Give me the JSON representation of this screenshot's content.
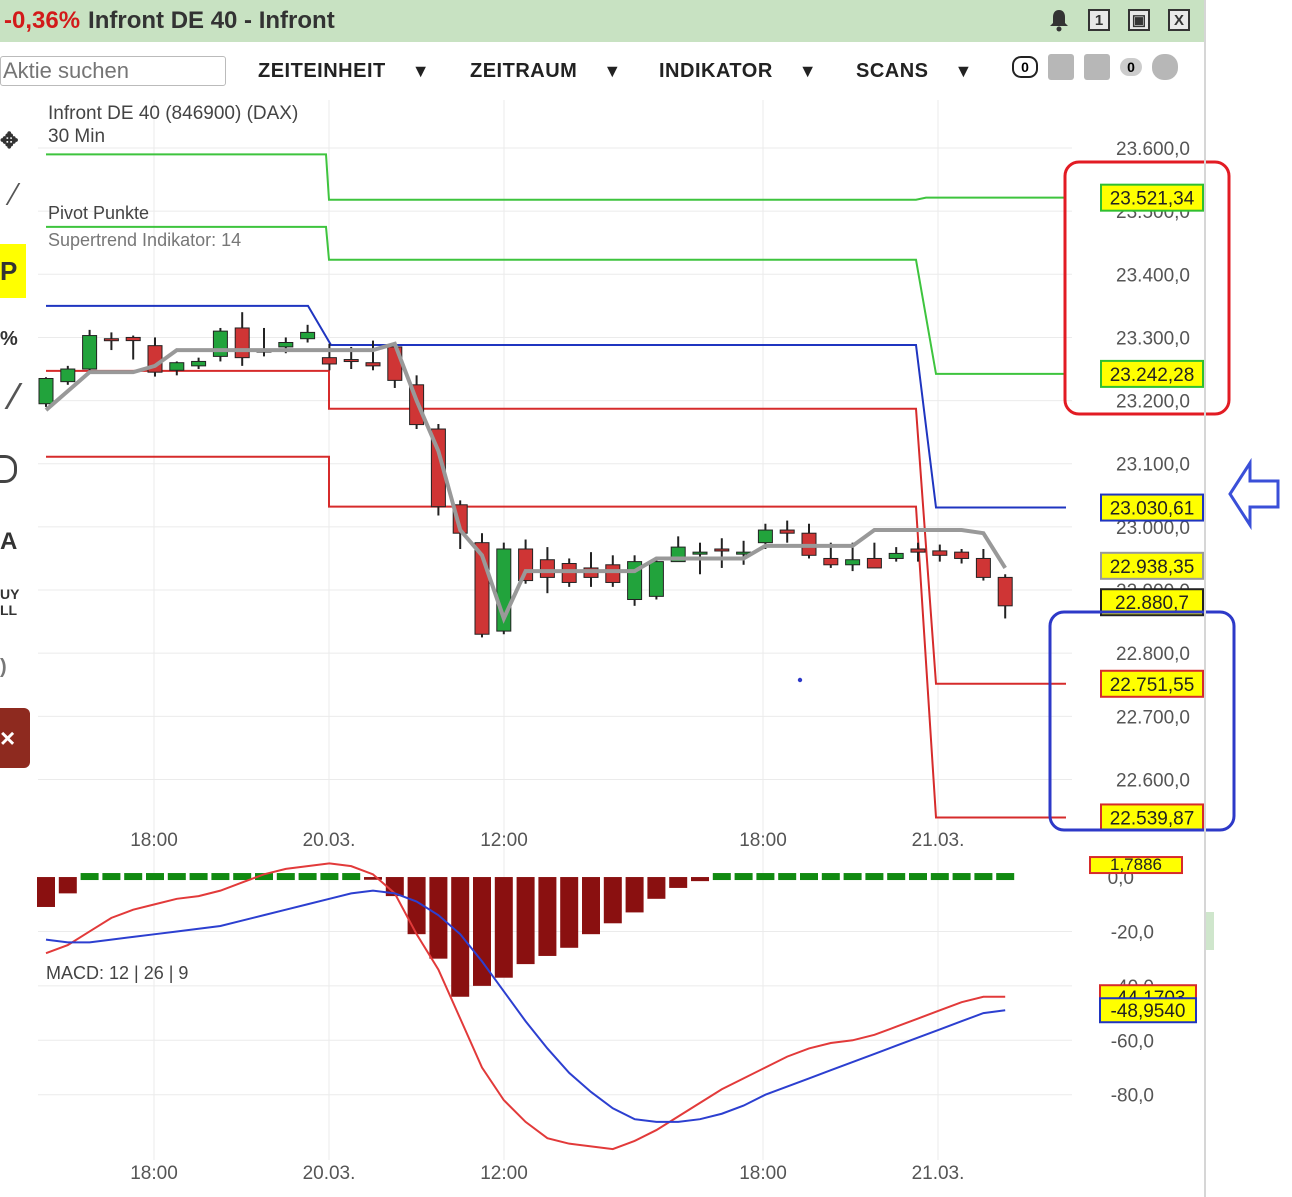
{
  "window": {
    "change": "-0,36%",
    "title": "Infront DE 40 - Infront",
    "buttons": [
      "1",
      "▣",
      "X"
    ]
  },
  "toolbar": {
    "search_placeholder": "Aktie suchen",
    "menus": [
      "ZEITEINHEIT",
      "ZEITRAUM",
      "INDIKATOR",
      "SCANS"
    ],
    "badge1": "0",
    "badge2": "0"
  },
  "tools": [
    "P",
    "%",
    "A",
    "UY",
    "LL"
  ],
  "chart_data": {
    "type": "candlestick",
    "title": "Infront DE 40 (846900) (DAX)",
    "subtitle": "30 Min",
    "indicators": [
      "Pivot Punkte",
      "Supertrend Indikator: 14"
    ],
    "price_ticks": [
      "23.600,0",
      "23.500,0",
      "23.400,0",
      "23.300,0",
      "23.200,0",
      "23.100,0",
      "23.000,0",
      "22.900,0",
      "22.800,0",
      "22.700,0",
      "22.600,0"
    ],
    "price_range": [
      22520,
      23600
    ],
    "x_labels": [
      "18:00",
      "20.03.",
      "12:00",
      "18:00",
      "21.03."
    ],
    "candles": [
      [
        23195,
        23237,
        23190,
        23235
      ],
      [
        23230,
        23255,
        23225,
        23250
      ],
      [
        23250,
        23312,
        23245,
        23303
      ],
      [
        23298,
        23308,
        23280,
        23296
      ],
      [
        23300,
        23303,
        23265,
        23295
      ],
      [
        23287,
        23300,
        23238,
        23245
      ],
      [
        23248,
        23262,
        23240,
        23260
      ],
      [
        23255,
        23268,
        23250,
        23262
      ],
      [
        23270,
        23315,
        23262,
        23310
      ],
      [
        23315,
        23340,
        23255,
        23268
      ],
      [
        23278,
        23315,
        23270,
        23280
      ],
      [
        23285,
        23300,
        23275,
        23292
      ],
      [
        23298,
        23320,
        23292,
        23308
      ],
      [
        23268,
        23290,
        23248,
        23258
      ],
      [
        23265,
        23285,
        23250,
        23262
      ],
      [
        23260,
        23295,
        23248,
        23255
      ],
      [
        23285,
        23290,
        23220,
        23232
      ],
      [
        23225,
        23240,
        23155,
        23162
      ],
      [
        23155,
        23163,
        23018,
        23032
      ],
      [
        23035,
        23042,
        22965,
        22990
      ],
      [
        22975,
        22990,
        22825,
        22830
      ],
      [
        22835,
        22975,
        22830,
        22965
      ],
      [
        22965,
        22980,
        22910,
        22915
      ],
      [
        22948,
        22968,
        22895,
        22920
      ],
      [
        22942,
        22950,
        22905,
        22912
      ],
      [
        22935,
        22960,
        22905,
        22920
      ],
      [
        22940,
        22955,
        22905,
        22912
      ],
      [
        22885,
        22955,
        22875,
        22945
      ],
      [
        22890,
        22948,
        22885,
        22945
      ],
      [
        22945,
        22985,
        22945,
        22968
      ],
      [
        22960,
        22975,
        22925,
        22960
      ],
      [
        22965,
        22982,
        22935,
        22962
      ],
      [
        22960,
        22978,
        22940,
        22960
      ],
      [
        22975,
        23005,
        22965,
        22995
      ],
      [
        22995,
        23010,
        22975,
        22990
      ],
      [
        22990,
        23005,
        22950,
        22955
      ],
      [
        22950,
        22975,
        22935,
        22940
      ],
      [
        22940,
        22975,
        22930,
        22948
      ],
      [
        22950,
        22975,
        22935,
        22935
      ],
      [
        22950,
        22968,
        22945,
        22958
      ],
      [
        22965,
        22975,
        22945,
        22960
      ],
      [
        22962,
        22972,
        22945,
        22955
      ],
      [
        22960,
        22965,
        22942,
        22950
      ],
      [
        22950,
        22965,
        22915,
        22920
      ],
      [
        22920,
        22925,
        22855,
        22875
      ]
    ],
    "supertrend": [
      23185,
      23215,
      23245,
      23245,
      23245,
      23255,
      23280,
      23280,
      23280,
      23280,
      23280,
      23280,
      23280,
      23280,
      23280,
      23280,
      23290,
      23200,
      23120,
      22995,
      22955,
      22855,
      22930,
      22930,
      22930,
      22930,
      22930,
      22930,
      22950,
      22950,
      22950,
      22950,
      22950,
      22970,
      22970,
      22970,
      22970,
      22970,
      22995,
      22995,
      22995,
      22995,
      22995,
      22990,
      22935
    ],
    "pivot_lines": [
      {
        "color": "#3ec43e",
        "points": [
          [
            0,
            23590
          ],
          [
            280,
            23590
          ],
          [
            283,
            23518
          ],
          [
            870,
            23518
          ],
          [
            880,
            23521.34
          ],
          [
            1020,
            23521.34
          ]
        ]
      },
      {
        "color": "#3ec43e",
        "points": [
          [
            0,
            23475
          ],
          [
            280,
            23475
          ],
          [
            283,
            23423
          ],
          [
            870,
            23423
          ],
          [
            890,
            23242.28
          ],
          [
            1020,
            23242.28
          ]
        ]
      },
      {
        "color": "#1f35c0",
        "points": [
          [
            0,
            23350
          ],
          [
            262,
            23350
          ],
          [
            285,
            23288
          ],
          [
            870,
            23288
          ],
          [
            890,
            23030.61
          ],
          [
            1020,
            23030.61
          ]
        ]
      },
      {
        "color": "#d62b2b",
        "points": [
          [
            0,
            23247
          ],
          [
            283,
            23247
          ],
          [
            283,
            23187
          ],
          [
            870,
            23187
          ],
          [
            890,
            22751.55
          ],
          [
            1020,
            22751.55
          ]
        ]
      },
      {
        "color": "#d62b2b",
        "points": [
          [
            0,
            23111
          ],
          [
            283,
            23111
          ],
          [
            283,
            23032
          ],
          [
            870,
            23032
          ],
          [
            890,
            22539.87
          ],
          [
            1020,
            22539.87
          ]
        ]
      }
    ],
    "price_labels": [
      {
        "text": "23.521,34",
        "value": 23521.34,
        "bg": "#ffff00",
        "border": "#2fbf2f"
      },
      {
        "text": "23.242,28",
        "value": 23242.28,
        "bg": "#ffff00",
        "border": "#2fbf2f"
      },
      {
        "text": "23.030,61",
        "value": 23030.61,
        "bg": "#ffff00",
        "border": "#1f35c0"
      },
      {
        "text": "22.938,35",
        "value": 22938.35,
        "bg": "#ffff00",
        "border": "#9a9a9a"
      },
      {
        "text": "22.880,7",
        "value": 22880.7,
        "bg": "#ffff00",
        "border": "#222222"
      },
      {
        "text": "22.751,55",
        "value": 22751.55,
        "bg": "#ffff00",
        "border": "#d62b2b"
      },
      {
        "text": "22.539,87",
        "value": 22539.87,
        "bg": "#ffff00",
        "border": "#d62b2b"
      }
    ],
    "macd": {
      "label": "MACD: 12 | 26 | 9",
      "ticks": [
        "-20,0",
        "-40,0",
        "-60,0",
        "-80,0"
      ],
      "zero_tick": "0,0",
      "range": [
        -104,
        7
      ],
      "histogram": [
        -11,
        -6,
        0.5,
        0.5,
        0.5,
        0.5,
        0.5,
        0.5,
        0.5,
        0.5,
        0.5,
        0.5,
        0.5,
        0.5,
        0.5,
        -1,
        -7,
        -21,
        -30,
        -44,
        -40,
        -37,
        -32,
        -29,
        -26,
        -21,
        -17,
        -13,
        -8,
        -4,
        -1.5,
        0.5,
        0.5,
        0.5,
        0.5,
        0.5,
        0.5,
        0.5,
        0.5,
        0.5,
        0.5,
        0.5,
        0.5,
        0.5,
        0.5
      ],
      "macd_line": [
        -28,
        -25,
        -20,
        -15,
        -12,
        -10,
        -8,
        -7,
        -5,
        -2,
        1,
        3,
        4,
        5,
        4,
        1,
        -6,
        -21,
        -34,
        -52,
        -70,
        -82,
        -90,
        -96,
        -98,
        -99,
        -100,
        -97,
        -93,
        -88,
        -83,
        -78,
        -74,
        -70,
        -66,
        -63,
        -61,
        -60,
        -58,
        -55,
        -52,
        -49,
        -46,
        -44,
        -44
      ],
      "signal_line": [
        -23,
        -24,
        -24,
        -23,
        -22,
        -21,
        -20,
        -19,
        -18,
        -16,
        -14,
        -12,
        -10,
        -8,
        -6,
        -5,
        -6,
        -9,
        -14,
        -21,
        -31,
        -42,
        -53,
        -63,
        -72,
        -79,
        -85,
        -89,
        -90,
        -90,
        -89,
        -87,
        -84,
        -80,
        -77,
        -74,
        -71,
        -68,
        -65,
        -62,
        -59,
        -56,
        -53,
        -50,
        -48.954
      ],
      "labels": [
        {
          "text": "-44,1703",
          "value": -44.1703,
          "bg": "#ffff00",
          "border": "#d62b2b"
        },
        {
          "text": "-48,9540",
          "value": -48.954,
          "bg": "#ffff00",
          "border": "#1f35c0"
        }
      ],
      "partial_label": "1,7886"
    }
  }
}
